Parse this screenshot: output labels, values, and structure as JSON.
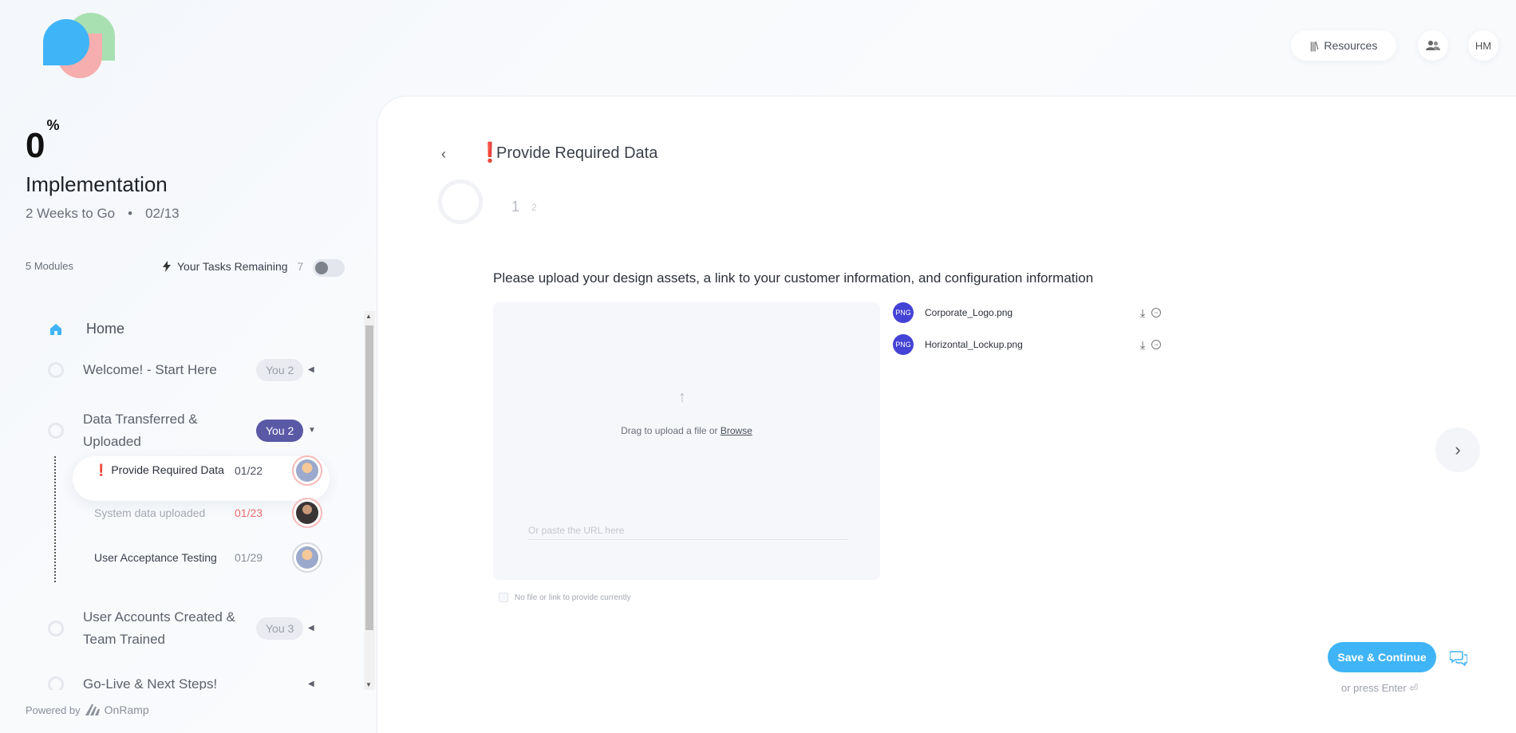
{
  "header": {
    "resources_label": "Resources",
    "avatar_initials": "HM"
  },
  "sidebar": {
    "progress_value": "0",
    "progress_unit": "%",
    "project_title": "Implementation",
    "time_left": "2 Weeks to Go",
    "separator": "•",
    "due_date": "02/13",
    "modules_count": "5 Modules",
    "tasks_remaining_label": "Your Tasks Remaining",
    "tasks_remaining_count": "7",
    "home_label": "Home",
    "modules": [
      {
        "label": "Welcome! - Start Here",
        "badge": "You 2",
        "badge_style": "light"
      },
      {
        "label": "Data Transferred & Uploaded",
        "badge": "You 2",
        "badge_style": "dark"
      },
      {
        "label": "User Accounts Created & Team Trained",
        "badge": "You 3",
        "badge_style": "light"
      },
      {
        "label": "Go-Live & Next Steps!",
        "badge": "",
        "badge_style": "none"
      }
    ],
    "tasks": [
      {
        "flag": "❗",
        "name": "Provide Required Data",
        "date": "01/22",
        "date_color": "#4a4f5a"
      },
      {
        "flag": "",
        "name": "System data uploaded",
        "date": "01/23",
        "date_color": "#e86d6d"
      },
      {
        "flag": "",
        "name": "User Acceptance Testing",
        "date": "01/29",
        "date_color": "#8a8f99"
      }
    ],
    "powered_by": "Powered by",
    "brand": "OnRamp"
  },
  "main": {
    "flag": "❗",
    "step_title": "Provide Required Data",
    "page_current": "1",
    "page_total": "2",
    "question": "Please upload your design assets, a link to your customer information, and configuration information",
    "drag_text": "Drag to upload a file or ",
    "browse_label": "Browse",
    "url_placeholder": "Or paste the URL here",
    "no_file_label": "No file or link to provide currently",
    "files": [
      {
        "type": "PNG",
        "name": "Corporate_Logo.png"
      },
      {
        "type": "PNG",
        "name": "Horizontal_Lockup.png"
      }
    ],
    "save_label": "Save & Continue",
    "press_enter": "or press Enter ⏎"
  },
  "colors": {
    "accent": "#3fb4f6",
    "badge_dark": "#5a59a6",
    "alert": "#e0262f",
    "file_badge": "#4542d6"
  }
}
